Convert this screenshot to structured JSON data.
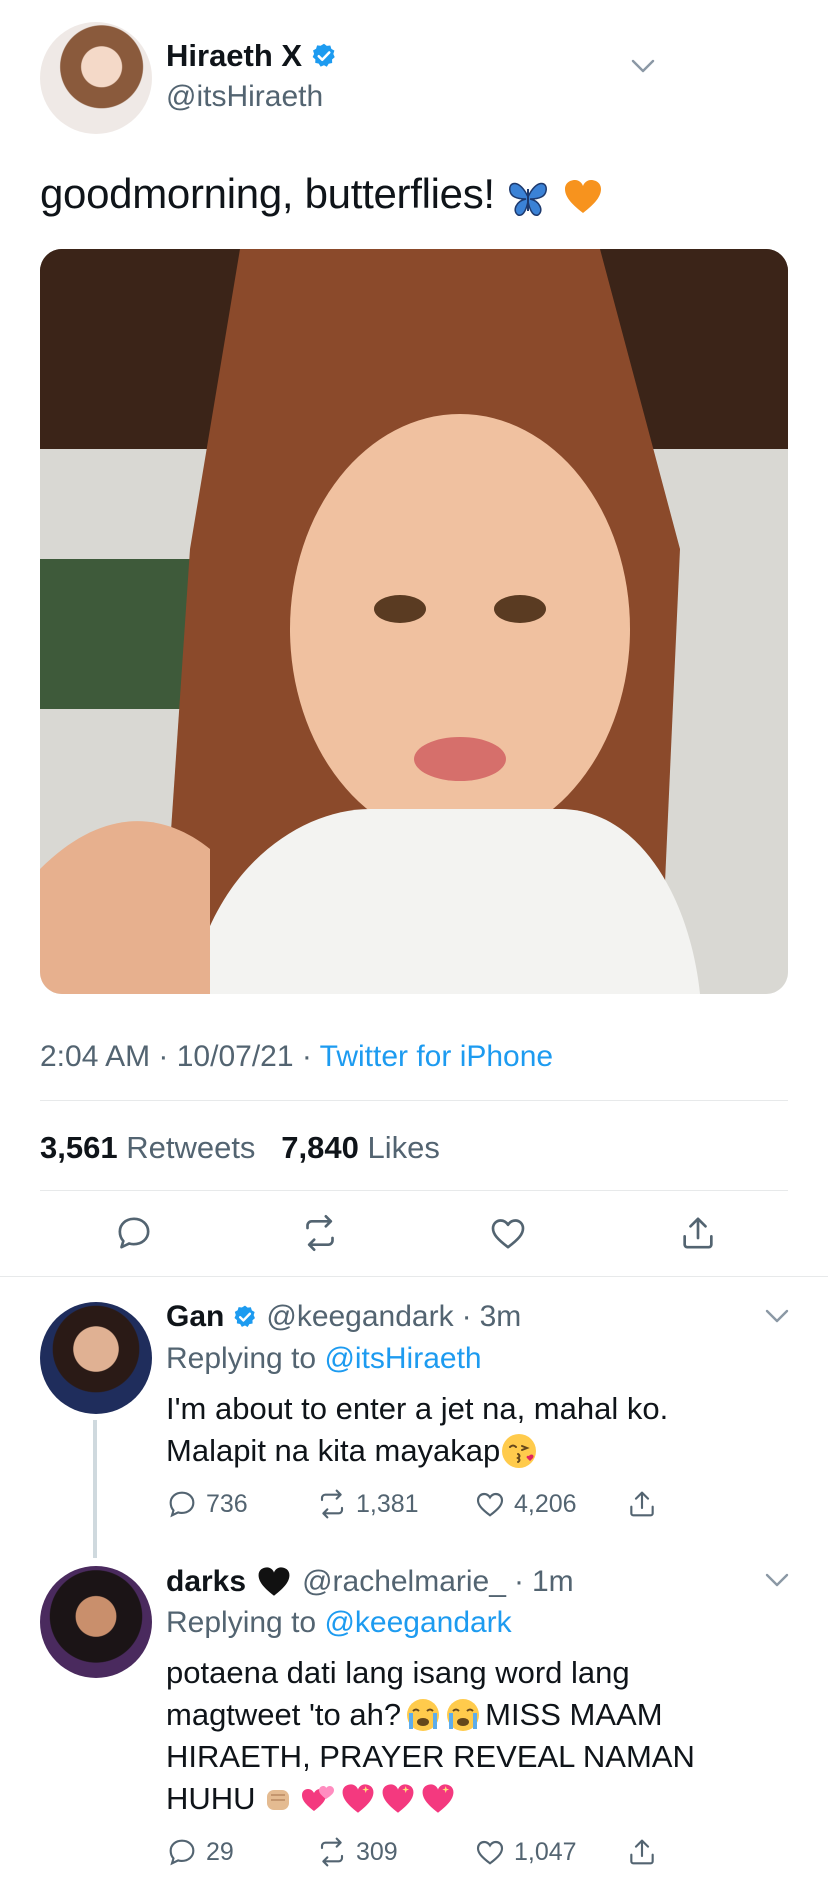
{
  "tweet": {
    "author_name": "Hiraeth X",
    "author_handle": "@itsHiraeth",
    "text": "goodmorning, butterflies!",
    "time": "2:04 AM",
    "date": "10/07/21",
    "source": "Twitter for iPhone",
    "retweets_count": "3,561",
    "retweets_label": "Retweets",
    "likes_count": "7,840",
    "likes_label": "Likes"
  },
  "replies": [
    {
      "name": "Gan",
      "handle": "@keegandark",
      "time": "3m",
      "replying_label": "Replying to",
      "replying_to": "@itsHiraeth",
      "lines": [
        "I'm about to enter a jet na, mahal ko.",
        "Malapit na kita mayakap"
      ],
      "replies": "736",
      "retweets": "1,381",
      "likes": "4,206"
    },
    {
      "name": "darks",
      "handle": "@rachelmarie_",
      "time": "1m",
      "replying_label": "Replying to",
      "replying_to": "@keegandark",
      "lines": [
        "potaena dati lang isang word lang",
        "magtweet 'to ah?",
        "MISS MAAM",
        "HIRAETH, PRAYER REVEAL NAMAN",
        "HUHU"
      ],
      "replies": "29",
      "retweets": "309",
      "likes": "1,047"
    }
  ],
  "colors": {
    "accent": "#1d9bf0",
    "secondary_text": "#536471",
    "divider": "#e7e9ea"
  },
  "icons": [
    "verified-badge-icon",
    "chevron-down-icon",
    "reply-icon",
    "retweet-icon",
    "like-icon",
    "share-icon",
    "butterfly-emoji",
    "orange-heart-emoji",
    "kiss-emoji",
    "crying-emoji",
    "fist-emoji",
    "sparkling-heart-emoji",
    "black-heart-emoji"
  ]
}
